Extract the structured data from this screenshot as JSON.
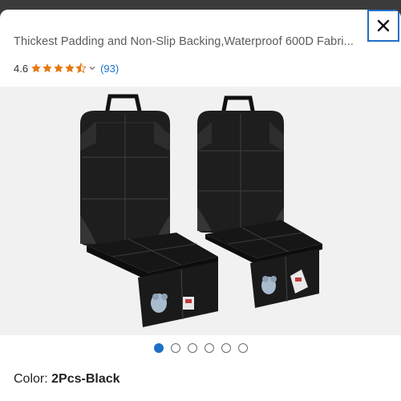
{
  "product": {
    "title": "Thickest Padding and Non-Slip Backing,Waterproof 600D Fabri...",
    "rating_value": "4.6",
    "rating_stars": 4.5,
    "review_count": "(93)"
  },
  "gallery": {
    "image_count": 6,
    "active_index": 0
  },
  "variant": {
    "color_label": "Color: ",
    "color_value": "2Pcs-Black"
  },
  "colors": {
    "accent": "#1f6fc5",
    "star": "#e47911",
    "link": "#1a73c8"
  },
  "icons": {
    "close": "close-icon"
  }
}
